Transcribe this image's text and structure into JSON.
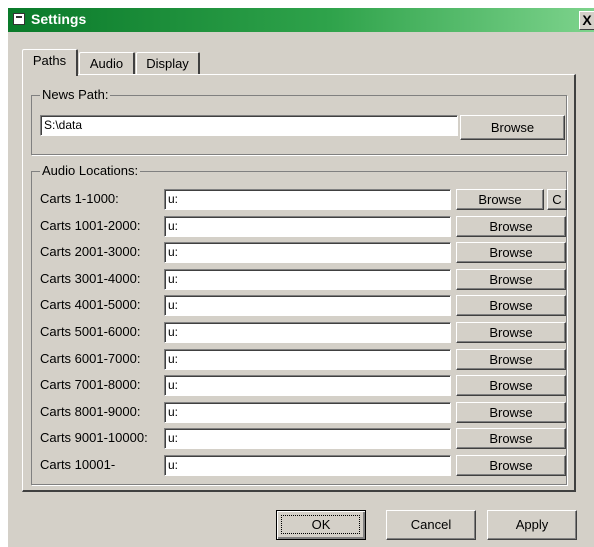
{
  "window": {
    "title": "Settings",
    "close_glyph": "X"
  },
  "tabs": [
    {
      "label": "Paths",
      "active": true
    },
    {
      "label": "Audio",
      "active": false
    },
    {
      "label": "Display",
      "active": false
    }
  ],
  "news_path": {
    "group_label": "News Path:",
    "value": "S:\\data",
    "browse_label": "Browse"
  },
  "audio_locations": {
    "group_label": "Audio Locations:",
    "browse_label": "Browse",
    "extra_button_label": "C",
    "rows": [
      {
        "label": "Carts 1-1000:",
        "value": "u:"
      },
      {
        "label": "Carts 1001-2000:",
        "value": "u:"
      },
      {
        "label": "Carts 2001-3000:",
        "value": "u:"
      },
      {
        "label": "Carts 3001-4000:",
        "value": "u:"
      },
      {
        "label": "Carts 4001-5000:",
        "value": "u:"
      },
      {
        "label": "Carts 5001-6000:",
        "value": "u:"
      },
      {
        "label": "Carts 6001-7000:",
        "value": "u:"
      },
      {
        "label": "Carts 7001-8000:",
        "value": "u:"
      },
      {
        "label": "Carts 8001-9000:",
        "value": "u:"
      },
      {
        "label": "Carts 9001-10000:",
        "value": "u:"
      },
      {
        "label": "Carts 10001-",
        "value": "u:"
      }
    ]
  },
  "footer": {
    "ok_label": "OK",
    "cancel_label": "Cancel",
    "apply_label": "Apply"
  },
  "colors": {
    "title_start": "#0a7a2a",
    "title_end": "#7dd38c",
    "face": "#d4d0c8"
  },
  "icons": {
    "title": "window-app-icon",
    "close": "close-icon"
  }
}
